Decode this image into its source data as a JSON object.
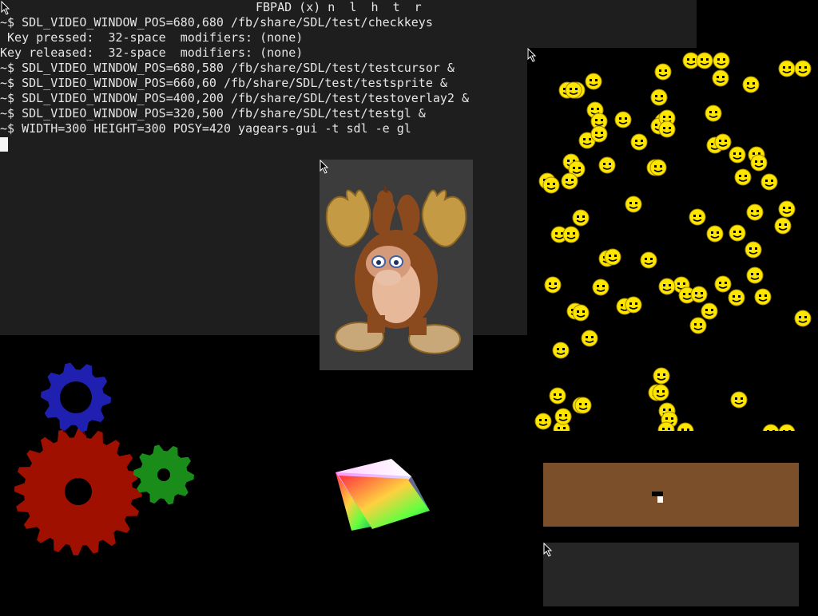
{
  "terminal": {
    "title": "FBPAD (x) n  l  h  t  r",
    "lines": [
      "~$ SDL_VIDEO_WINDOW_POS=680,680 /fb/share/SDL/test/checkkeys",
      " Key pressed:  32-space  modifiers: (none)",
      "Key released:  32-space  modifiers: (none)",
      "~$ SDL_VIDEO_WINDOW_POS=680,580 /fb/share/SDL/test/testcursor &",
      "~$ SDL_VIDEO_WINDOW_POS=660,60 /fb/share/SDL/test/testsprite &",
      "~$ SDL_VIDEO_WINDOW_POS=400,200 /fb/share/SDL/test/testoverlay2 &",
      "~$ SDL_VIDEO_WINDOW_POS=320,500 /fb/share/SDL/test/testgl &",
      "~$ WIDTH=300 HEIGHT=300 POSY=420 yagears-gui -t sdl -e gl"
    ]
  },
  "colors": {
    "terminal_bg": "#1e1e1e",
    "terminal_fg": "#e6e6e6",
    "smiley": "#ffe600",
    "gear_red": "#a01000",
    "gear_green": "#1a8c1a",
    "gear_blue": "#2020b0",
    "cursor_window_bg": "#7a4f2a",
    "overlay_bg": "#3c3c3c"
  },
  "icons": [
    "mouse-pointer-icon",
    "smiley-face-icon",
    "gear-icon",
    "moose-sprite",
    "rgb-cube"
  ]
}
